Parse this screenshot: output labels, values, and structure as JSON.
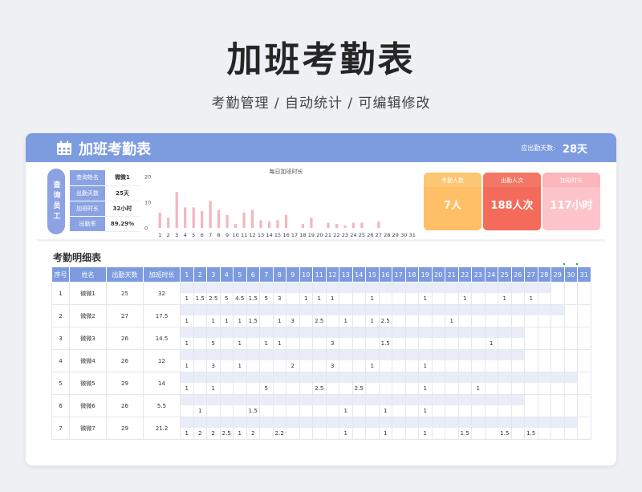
{
  "page": {
    "title": "加班考勤表",
    "subtitle": "考勤管理 /  自动统计  /  可编辑修改"
  },
  "sheet": {
    "title": "加班考勤表",
    "due_label": "应出勤天数:",
    "due_value": "28天",
    "query_tag": "查询员工",
    "query": [
      {
        "label": "查询姓名",
        "value": "微微1"
      },
      {
        "label": "出勤天数",
        "value": "25天"
      },
      {
        "label": "加班时长",
        "value": "32小时"
      },
      {
        "label": "出勤率",
        "value": "89.29%"
      }
    ],
    "stats": [
      {
        "label": "考勤人数",
        "value": "7人"
      },
      {
        "label": "出勤人次",
        "value": "188人次"
      },
      {
        "label": "加班时长",
        "value": "117小时"
      }
    ],
    "detail_title": "考勤明细表",
    "columns": [
      "序号",
      "姓名",
      "出勤天数",
      "加班时长"
    ],
    "day_columns": [
      "1",
      "2",
      "3",
      "4",
      "5",
      "6",
      "7",
      "8",
      "9",
      "10",
      "11",
      "12",
      "13",
      "14",
      "15",
      "16",
      "17",
      "18",
      "19",
      "20",
      "21",
      "22",
      "23",
      "24",
      "25",
      "26",
      "27",
      "28",
      "29",
      "30",
      "31"
    ],
    "rows": [
      {
        "no": "1",
        "name": "微微1",
        "days": "25",
        "hours": "32",
        "bar": [
          1,
          1,
          1,
          1,
          1,
          1,
          1,
          1,
          1,
          1,
          1,
          1,
          1,
          1,
          1,
          1,
          1,
          1,
          1,
          1,
          1,
          1,
          1,
          1,
          1,
          1,
          1,
          1,
          0,
          0,
          0
        ],
        "vals": [
          "1",
          "1.5",
          "2.5",
          "5",
          "4.5",
          "1.5",
          "5",
          "3",
          "",
          "1",
          "1",
          "1",
          "",
          "",
          "1",
          "",
          "",
          "",
          "1",
          "",
          "",
          "1",
          "",
          "",
          "1",
          "",
          "1",
          "",
          "",
          "",
          ""
        ]
      },
      {
        "no": "2",
        "name": "微微2",
        "days": "27",
        "hours": "17.5",
        "bar": [
          1,
          1,
          1,
          1,
          1,
          1,
          1,
          1,
          1,
          1,
          1,
          1,
          1,
          1,
          1,
          1,
          1,
          1,
          1,
          1,
          1,
          1,
          1,
          1,
          1,
          1,
          1,
          1,
          1,
          0,
          0
        ],
        "vals": [
          "1",
          "",
          "1",
          "1",
          "1",
          "1.5",
          "",
          "1",
          "3",
          "",
          "2.5",
          "",
          "1",
          "",
          "1",
          "2.5",
          "",
          "",
          "",
          "",
          "1",
          "",
          "",
          "",
          "",
          "",
          "",
          "",
          "",
          "",
          ""
        ]
      },
      {
        "no": "3",
        "name": "微微3",
        "days": "26",
        "hours": "14.5",
        "bar": [
          1,
          1,
          1,
          1,
          1,
          1,
          1,
          1,
          1,
          1,
          1,
          1,
          1,
          1,
          1,
          1,
          1,
          1,
          1,
          1,
          1,
          1,
          1,
          1,
          1,
          1,
          0,
          0,
          0,
          0,
          0
        ],
        "vals": [
          "1",
          "",
          "5",
          "",
          "1",
          "",
          "1",
          "1",
          "",
          "",
          "",
          "3",
          "",
          "",
          "",
          "1.5",
          "",
          "",
          "",
          "",
          "",
          "",
          "",
          "1",
          "",
          "",
          "",
          "",
          "",
          "",
          ""
        ]
      },
      {
        "no": "4",
        "name": "微微4",
        "days": "26",
        "hours": "12",
        "bar": [
          1,
          1,
          1,
          1,
          1,
          1,
          1,
          1,
          1,
          1,
          1,
          1,
          1,
          1,
          1,
          1,
          1,
          1,
          1,
          1,
          1,
          1,
          1,
          1,
          1,
          1,
          0,
          0,
          0,
          0,
          0
        ],
        "vals": [
          "1",
          "",
          "3",
          "",
          "1",
          "",
          "",
          "",
          "2",
          "",
          "",
          "3",
          "",
          "",
          "1",
          "",
          "",
          "",
          "1",
          "",
          "",
          "",
          "",
          "",
          "",
          "",
          "",
          "",
          "",
          "",
          ""
        ]
      },
      {
        "no": "5",
        "name": "微微5",
        "days": "29",
        "hours": "14",
        "bar": [
          1,
          1,
          1,
          1,
          1,
          1,
          1,
          1,
          1,
          1,
          1,
          1,
          1,
          1,
          1,
          1,
          1,
          1,
          1,
          1,
          1,
          1,
          1,
          1,
          1,
          1,
          1,
          1,
          1,
          1,
          0
        ],
        "vals": [
          "1",
          "",
          "1",
          "",
          "",
          "",
          "5",
          "",
          "",
          "",
          "2.5",
          "",
          "",
          "2.5",
          "",
          "",
          "",
          "",
          "1",
          "",
          "",
          "",
          "1",
          "",
          "",
          "",
          "",
          "",
          "",
          "",
          ""
        ]
      },
      {
        "no": "6",
        "name": "微微6",
        "days": "26",
        "hours": "5.5",
        "bar": [
          1,
          1,
          1,
          1,
          1,
          1,
          1,
          1,
          1,
          1,
          1,
          1,
          1,
          1,
          1,
          1,
          1,
          1,
          1,
          1,
          1,
          1,
          1,
          1,
          1,
          1,
          0,
          0,
          0,
          0,
          0
        ],
        "vals": [
          "",
          "1",
          "",
          "",
          "",
          "1.5",
          "",
          "",
          "",
          "",
          "",
          "",
          "1",
          "",
          "",
          "1",
          "",
          "",
          "1",
          "",
          "",
          "",
          "",
          "",
          "",
          "",
          "",
          "",
          "",
          "",
          ""
        ]
      },
      {
        "no": "7",
        "name": "微微7",
        "days": "29",
        "hours": "21.2",
        "bar": [
          1,
          1,
          1,
          1,
          1,
          1,
          1,
          1,
          1,
          1,
          1,
          1,
          1,
          1,
          1,
          1,
          1,
          1,
          1,
          1,
          1,
          1,
          1,
          1,
          1,
          1,
          1,
          1,
          1,
          1,
          0
        ],
        "vals": [
          "1",
          "2",
          "2",
          "2.5",
          "1",
          "2",
          "",
          "2.2",
          "",
          "",
          "",
          "",
          "1",
          "",
          "",
          "1",
          "",
          "",
          "1",
          "",
          "",
          "1.5",
          "",
          "",
          "1.5",
          "",
          "1.5",
          "",
          "",
          "",
          ""
        ]
      }
    ]
  },
  "chart_data": {
    "type": "bar",
    "title": "每日加班时长",
    "categories": [
      "1",
      "2",
      "3",
      "4",
      "5",
      "6",
      "7",
      "8",
      "9",
      "10",
      "11",
      "12",
      "13",
      "14",
      "15",
      "16",
      "17",
      "18",
      "19",
      "20",
      "21",
      "22",
      "23",
      "24",
      "25",
      "26",
      "27",
      "28",
      "29",
      "30",
      "31"
    ],
    "values": [
      6,
      4,
      14,
      8,
      8,
      6.5,
      10.5,
      7,
      5,
      1.5,
      6,
      7,
      3,
      2.5,
      3,
      5,
      0,
      1.5,
      4,
      0,
      2,
      1.5,
      1,
      2,
      2,
      0,
      2.5,
      0,
      0,
      0,
      0
    ],
    "ylim": [
      0,
      20
    ],
    "yticks": [
      "20",
      "10",
      "0"
    ],
    "bar_color": "#f4b6bb",
    "grid": false
  },
  "colors": {
    "header": "#7d9bdf",
    "accent_blue": "#8ba3e3",
    "stat_orange": "#ffbf66",
    "stat_red": "#f46b5b",
    "stat_pink": "#fdc5cb"
  }
}
